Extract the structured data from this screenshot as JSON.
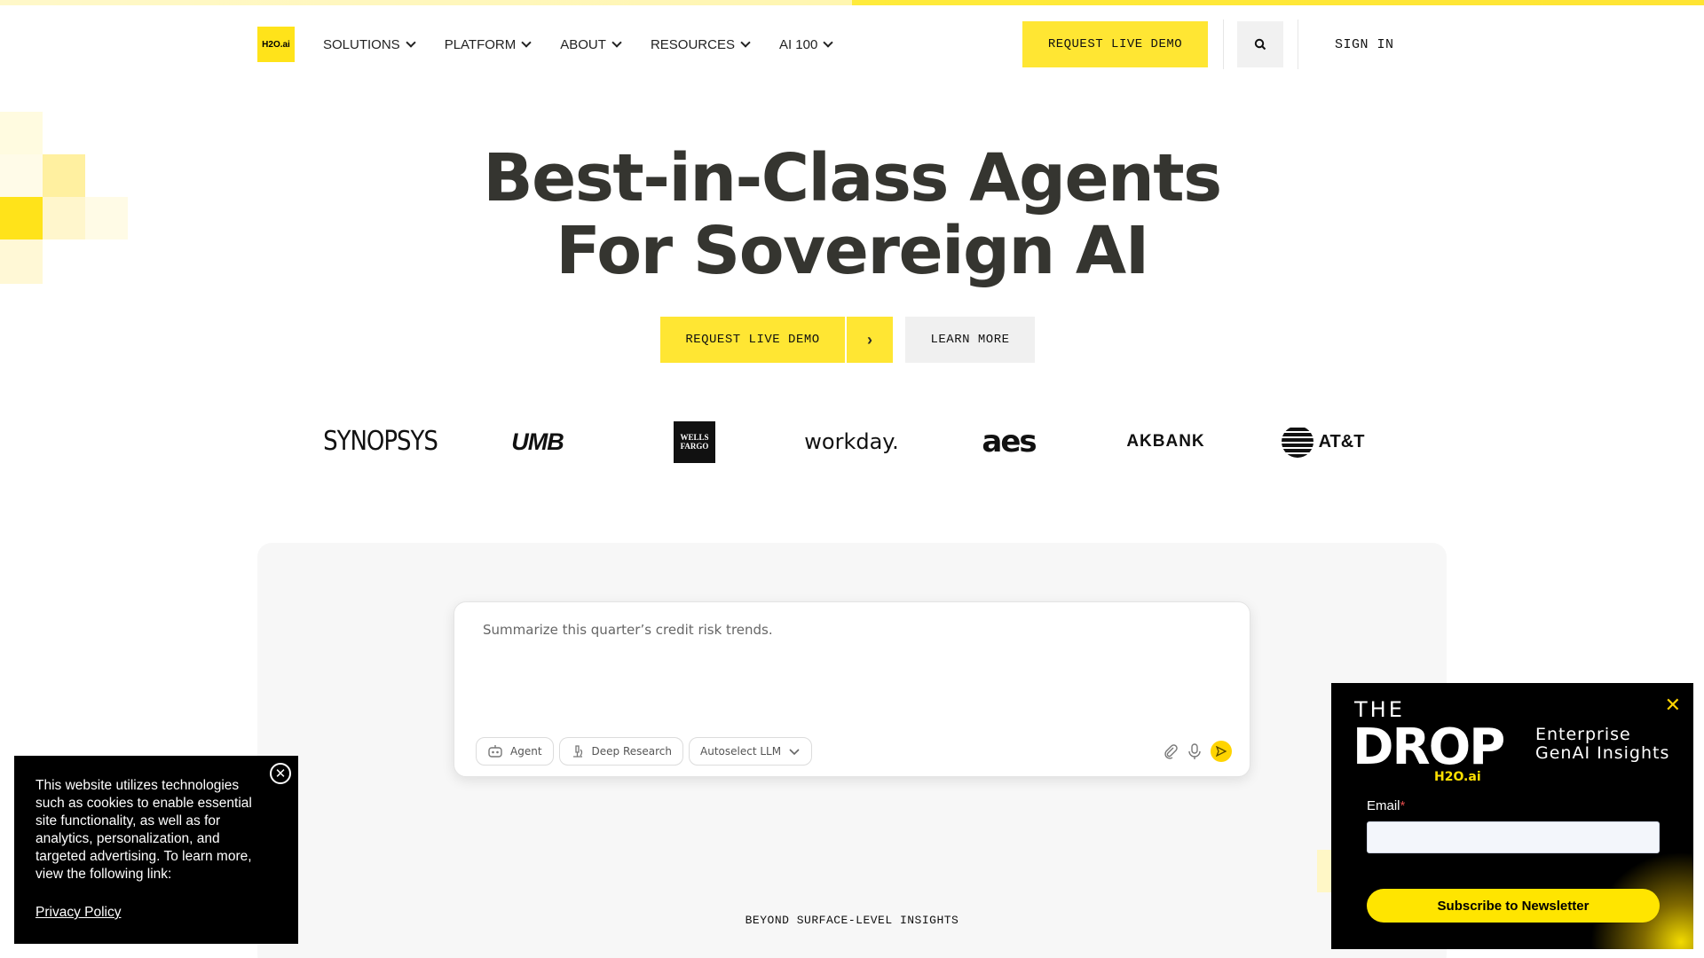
{
  "brand": {
    "logo_text": "H2O.ai",
    "accent": "#ffe633"
  },
  "nav": {
    "items": [
      {
        "label": "SOLUTIONS"
      },
      {
        "label": "PLATFORM"
      },
      {
        "label": "ABOUT"
      },
      {
        "label": "RESOURCES"
      },
      {
        "label": "AI 100"
      }
    ]
  },
  "header": {
    "demo_label": "REQUEST LIVE DEMO",
    "search_icon": "search-icon",
    "signin_label": "SIGN IN"
  },
  "hero": {
    "title_line1": "Best-in-Class Agents",
    "title_line2": "For Sovereign AI",
    "demo_label": "REQUEST LIVE DEMO",
    "arrow": "›",
    "learn_label": "LEARN MORE"
  },
  "logos": {
    "synopsys": "SYNOPSYS",
    "umb": "UMB",
    "wells_line1": "WELLS",
    "wells_line2": "FARGO",
    "workday": "workday.",
    "aes": "aes",
    "akbank": "AKBANK",
    "att": "AT&T"
  },
  "chat": {
    "prompt_value": "Summarize this quarter’s credit risk trends.",
    "chip_agent": "Agent",
    "chip_research": "Deep Research",
    "chip_llm": "Autoselect LLM"
  },
  "section": {
    "kicker": "BEYOND SURFACE-LEVEL INSIGHTS"
  },
  "cookie": {
    "text": "This website utilizes technologies such as cookies to enable essential site functionality, as well as for analytics, personalization, and targeted advertising. To learn more, view the following link:",
    "link": "Privacy Policy",
    "close": "✕"
  },
  "newsletter": {
    "the": "THE",
    "word": "DROP",
    "brand": "H2O.ai",
    "tag_line1": "Enterprise",
    "tag_line2": "GenAI Insights",
    "email_label": "Email",
    "required_mark": "*",
    "button": "Subscribe to Newsletter",
    "close": "✕"
  }
}
